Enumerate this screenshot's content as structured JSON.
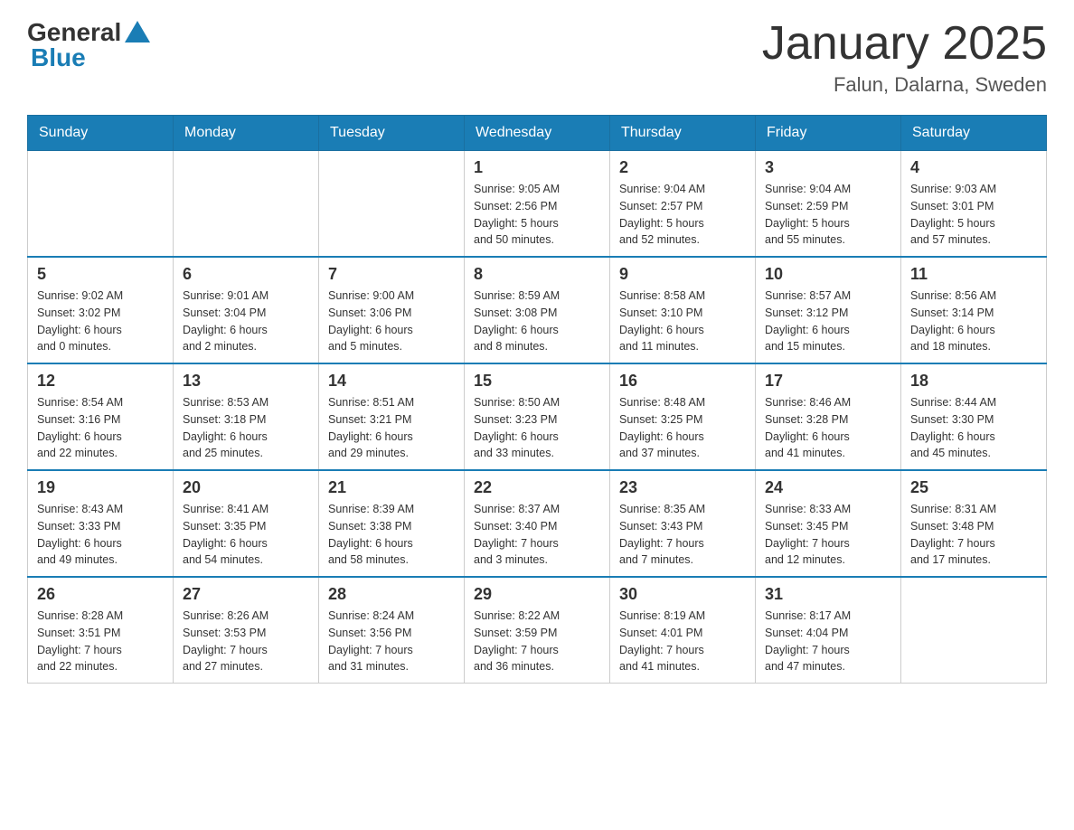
{
  "header": {
    "logo_general": "General",
    "logo_blue": "Blue",
    "month_title": "January 2025",
    "subtitle": "Falun, Dalarna, Sweden"
  },
  "days_of_week": [
    "Sunday",
    "Monday",
    "Tuesday",
    "Wednesday",
    "Thursday",
    "Friday",
    "Saturday"
  ],
  "weeks": [
    [
      {
        "num": "",
        "info": ""
      },
      {
        "num": "",
        "info": ""
      },
      {
        "num": "",
        "info": ""
      },
      {
        "num": "1",
        "info": "Sunrise: 9:05 AM\nSunset: 2:56 PM\nDaylight: 5 hours\nand 50 minutes."
      },
      {
        "num": "2",
        "info": "Sunrise: 9:04 AM\nSunset: 2:57 PM\nDaylight: 5 hours\nand 52 minutes."
      },
      {
        "num": "3",
        "info": "Sunrise: 9:04 AM\nSunset: 2:59 PM\nDaylight: 5 hours\nand 55 minutes."
      },
      {
        "num": "4",
        "info": "Sunrise: 9:03 AM\nSunset: 3:01 PM\nDaylight: 5 hours\nand 57 minutes."
      }
    ],
    [
      {
        "num": "5",
        "info": "Sunrise: 9:02 AM\nSunset: 3:02 PM\nDaylight: 6 hours\nand 0 minutes."
      },
      {
        "num": "6",
        "info": "Sunrise: 9:01 AM\nSunset: 3:04 PM\nDaylight: 6 hours\nand 2 minutes."
      },
      {
        "num": "7",
        "info": "Sunrise: 9:00 AM\nSunset: 3:06 PM\nDaylight: 6 hours\nand 5 minutes."
      },
      {
        "num": "8",
        "info": "Sunrise: 8:59 AM\nSunset: 3:08 PM\nDaylight: 6 hours\nand 8 minutes."
      },
      {
        "num": "9",
        "info": "Sunrise: 8:58 AM\nSunset: 3:10 PM\nDaylight: 6 hours\nand 11 minutes."
      },
      {
        "num": "10",
        "info": "Sunrise: 8:57 AM\nSunset: 3:12 PM\nDaylight: 6 hours\nand 15 minutes."
      },
      {
        "num": "11",
        "info": "Sunrise: 8:56 AM\nSunset: 3:14 PM\nDaylight: 6 hours\nand 18 minutes."
      }
    ],
    [
      {
        "num": "12",
        "info": "Sunrise: 8:54 AM\nSunset: 3:16 PM\nDaylight: 6 hours\nand 22 minutes."
      },
      {
        "num": "13",
        "info": "Sunrise: 8:53 AM\nSunset: 3:18 PM\nDaylight: 6 hours\nand 25 minutes."
      },
      {
        "num": "14",
        "info": "Sunrise: 8:51 AM\nSunset: 3:21 PM\nDaylight: 6 hours\nand 29 minutes."
      },
      {
        "num": "15",
        "info": "Sunrise: 8:50 AM\nSunset: 3:23 PM\nDaylight: 6 hours\nand 33 minutes."
      },
      {
        "num": "16",
        "info": "Sunrise: 8:48 AM\nSunset: 3:25 PM\nDaylight: 6 hours\nand 37 minutes."
      },
      {
        "num": "17",
        "info": "Sunrise: 8:46 AM\nSunset: 3:28 PM\nDaylight: 6 hours\nand 41 minutes."
      },
      {
        "num": "18",
        "info": "Sunrise: 8:44 AM\nSunset: 3:30 PM\nDaylight: 6 hours\nand 45 minutes."
      }
    ],
    [
      {
        "num": "19",
        "info": "Sunrise: 8:43 AM\nSunset: 3:33 PM\nDaylight: 6 hours\nand 49 minutes."
      },
      {
        "num": "20",
        "info": "Sunrise: 8:41 AM\nSunset: 3:35 PM\nDaylight: 6 hours\nand 54 minutes."
      },
      {
        "num": "21",
        "info": "Sunrise: 8:39 AM\nSunset: 3:38 PM\nDaylight: 6 hours\nand 58 minutes."
      },
      {
        "num": "22",
        "info": "Sunrise: 8:37 AM\nSunset: 3:40 PM\nDaylight: 7 hours\nand 3 minutes."
      },
      {
        "num": "23",
        "info": "Sunrise: 8:35 AM\nSunset: 3:43 PM\nDaylight: 7 hours\nand 7 minutes."
      },
      {
        "num": "24",
        "info": "Sunrise: 8:33 AM\nSunset: 3:45 PM\nDaylight: 7 hours\nand 12 minutes."
      },
      {
        "num": "25",
        "info": "Sunrise: 8:31 AM\nSunset: 3:48 PM\nDaylight: 7 hours\nand 17 minutes."
      }
    ],
    [
      {
        "num": "26",
        "info": "Sunrise: 8:28 AM\nSunset: 3:51 PM\nDaylight: 7 hours\nand 22 minutes."
      },
      {
        "num": "27",
        "info": "Sunrise: 8:26 AM\nSunset: 3:53 PM\nDaylight: 7 hours\nand 27 minutes."
      },
      {
        "num": "28",
        "info": "Sunrise: 8:24 AM\nSunset: 3:56 PM\nDaylight: 7 hours\nand 31 minutes."
      },
      {
        "num": "29",
        "info": "Sunrise: 8:22 AM\nSunset: 3:59 PM\nDaylight: 7 hours\nand 36 minutes."
      },
      {
        "num": "30",
        "info": "Sunrise: 8:19 AM\nSunset: 4:01 PM\nDaylight: 7 hours\nand 41 minutes."
      },
      {
        "num": "31",
        "info": "Sunrise: 8:17 AM\nSunset: 4:04 PM\nDaylight: 7 hours\nand 47 minutes."
      },
      {
        "num": "",
        "info": ""
      }
    ]
  ]
}
